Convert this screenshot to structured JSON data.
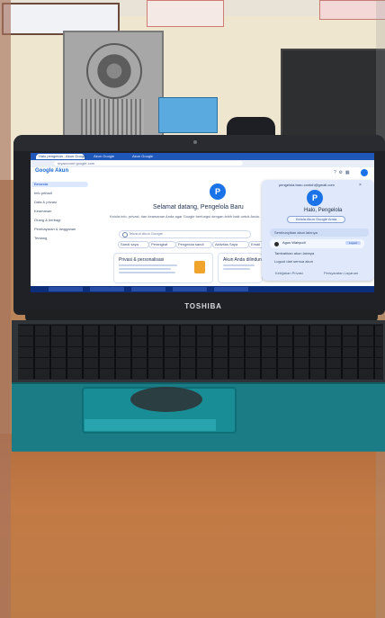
{
  "browser": {
    "tabs": [
      "Halo pengelola - Akun Google",
      "Akun Google",
      "Akun Google"
    ],
    "url": "myaccount.google.com"
  },
  "app": {
    "logo": "Google Akun",
    "sidebar": [
      "Beranda",
      "Info pribadi",
      "Data & privasi",
      "Keamanan",
      "Orang & berbagi",
      "Pembayaran & langganan",
      "Tentang"
    ],
    "search_placeholder": "Telusuri Akun Google",
    "welcome_title": "Selamat datang, Pengelola Baru",
    "welcome_subtitle": "Kelola info, privasi, dan keamanan Anda agar Google berfungsi dengan lebih baik untuk Anda.",
    "chips": [
      "Sandi saya",
      "Perangkat",
      "Pengelola sandi",
      "Aktivitas Saya",
      "Email"
    ],
    "cards": [
      {
        "title": "Privasi & personalisasi"
      },
      {
        "title": "Akun Anda dilindungi"
      }
    ],
    "avatar_letter": "P"
  },
  "popup": {
    "email": "pengelola.baru.contoh@gmail.com",
    "close": "×",
    "avatar_letter": "P",
    "greeting": "Halo, Pengelola",
    "manage": "Kelola Akun Google Anda",
    "section": "Sembunyikan akun lainnya",
    "account_name": "Agus Wahyudi",
    "account_tag": "Logout",
    "add_account": "Tambahkan akun lainnya",
    "sign_out": "Logout dari semua akun",
    "footer_left": "Kebijakan Privasi",
    "footer_right": "Persyaratan Layanan"
  },
  "hardware": {
    "brand": "TOSHIBA"
  }
}
